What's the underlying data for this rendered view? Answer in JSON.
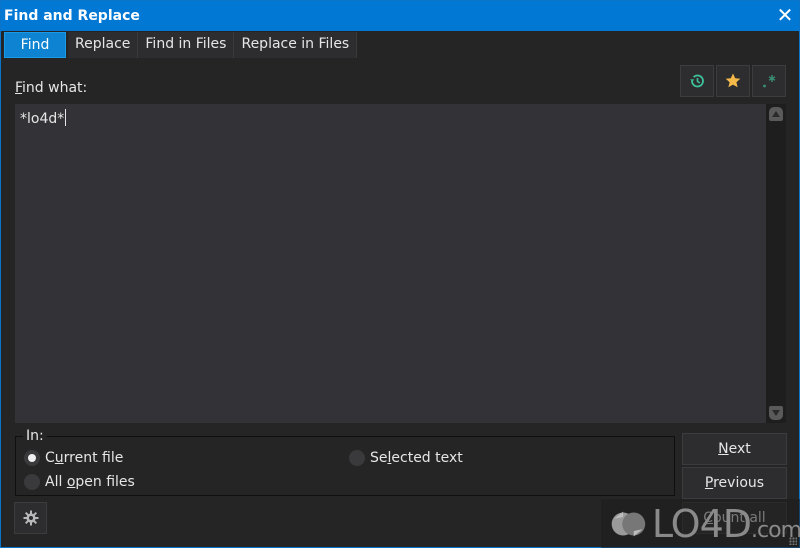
{
  "window": {
    "title": "Find and Replace",
    "close_icon": "close-icon"
  },
  "tabs": [
    {
      "label": "Find",
      "active": true
    },
    {
      "label": "Replace",
      "active": false
    },
    {
      "label": "Find in Files",
      "active": false
    },
    {
      "label": "Replace in Files",
      "active": false
    }
  ],
  "find": {
    "label_access": "F",
    "label_rest": "ind what:",
    "value": "*lo4d*"
  },
  "toolbar": {
    "history_icon": "history-icon",
    "favorites_icon": "star-icon",
    "regex_icon": "regex-icon",
    "colors": {
      "history": "#3cc29a",
      "star": "#f5b94a",
      "regex": "#3a8f74"
    }
  },
  "scope": {
    "label": "In:",
    "options": [
      {
        "pre": "C",
        "access": "u",
        "post": "rrent file",
        "selected": true
      },
      {
        "pre": "All ",
        "access": "o",
        "post": "pen files",
        "selected": false
      },
      {
        "pre": "Se",
        "access": "l",
        "post": "ected text",
        "selected": false
      }
    ]
  },
  "actions": {
    "next": {
      "access": "N",
      "rest": "ext"
    },
    "previous": {
      "access": "P",
      "rest": "revious"
    },
    "count_all": {
      "access": "C",
      "rest": "ount all"
    }
  },
  "settings_icon": "gear-icon",
  "watermark": {
    "main": "LO4D",
    "suffix": ".com"
  }
}
